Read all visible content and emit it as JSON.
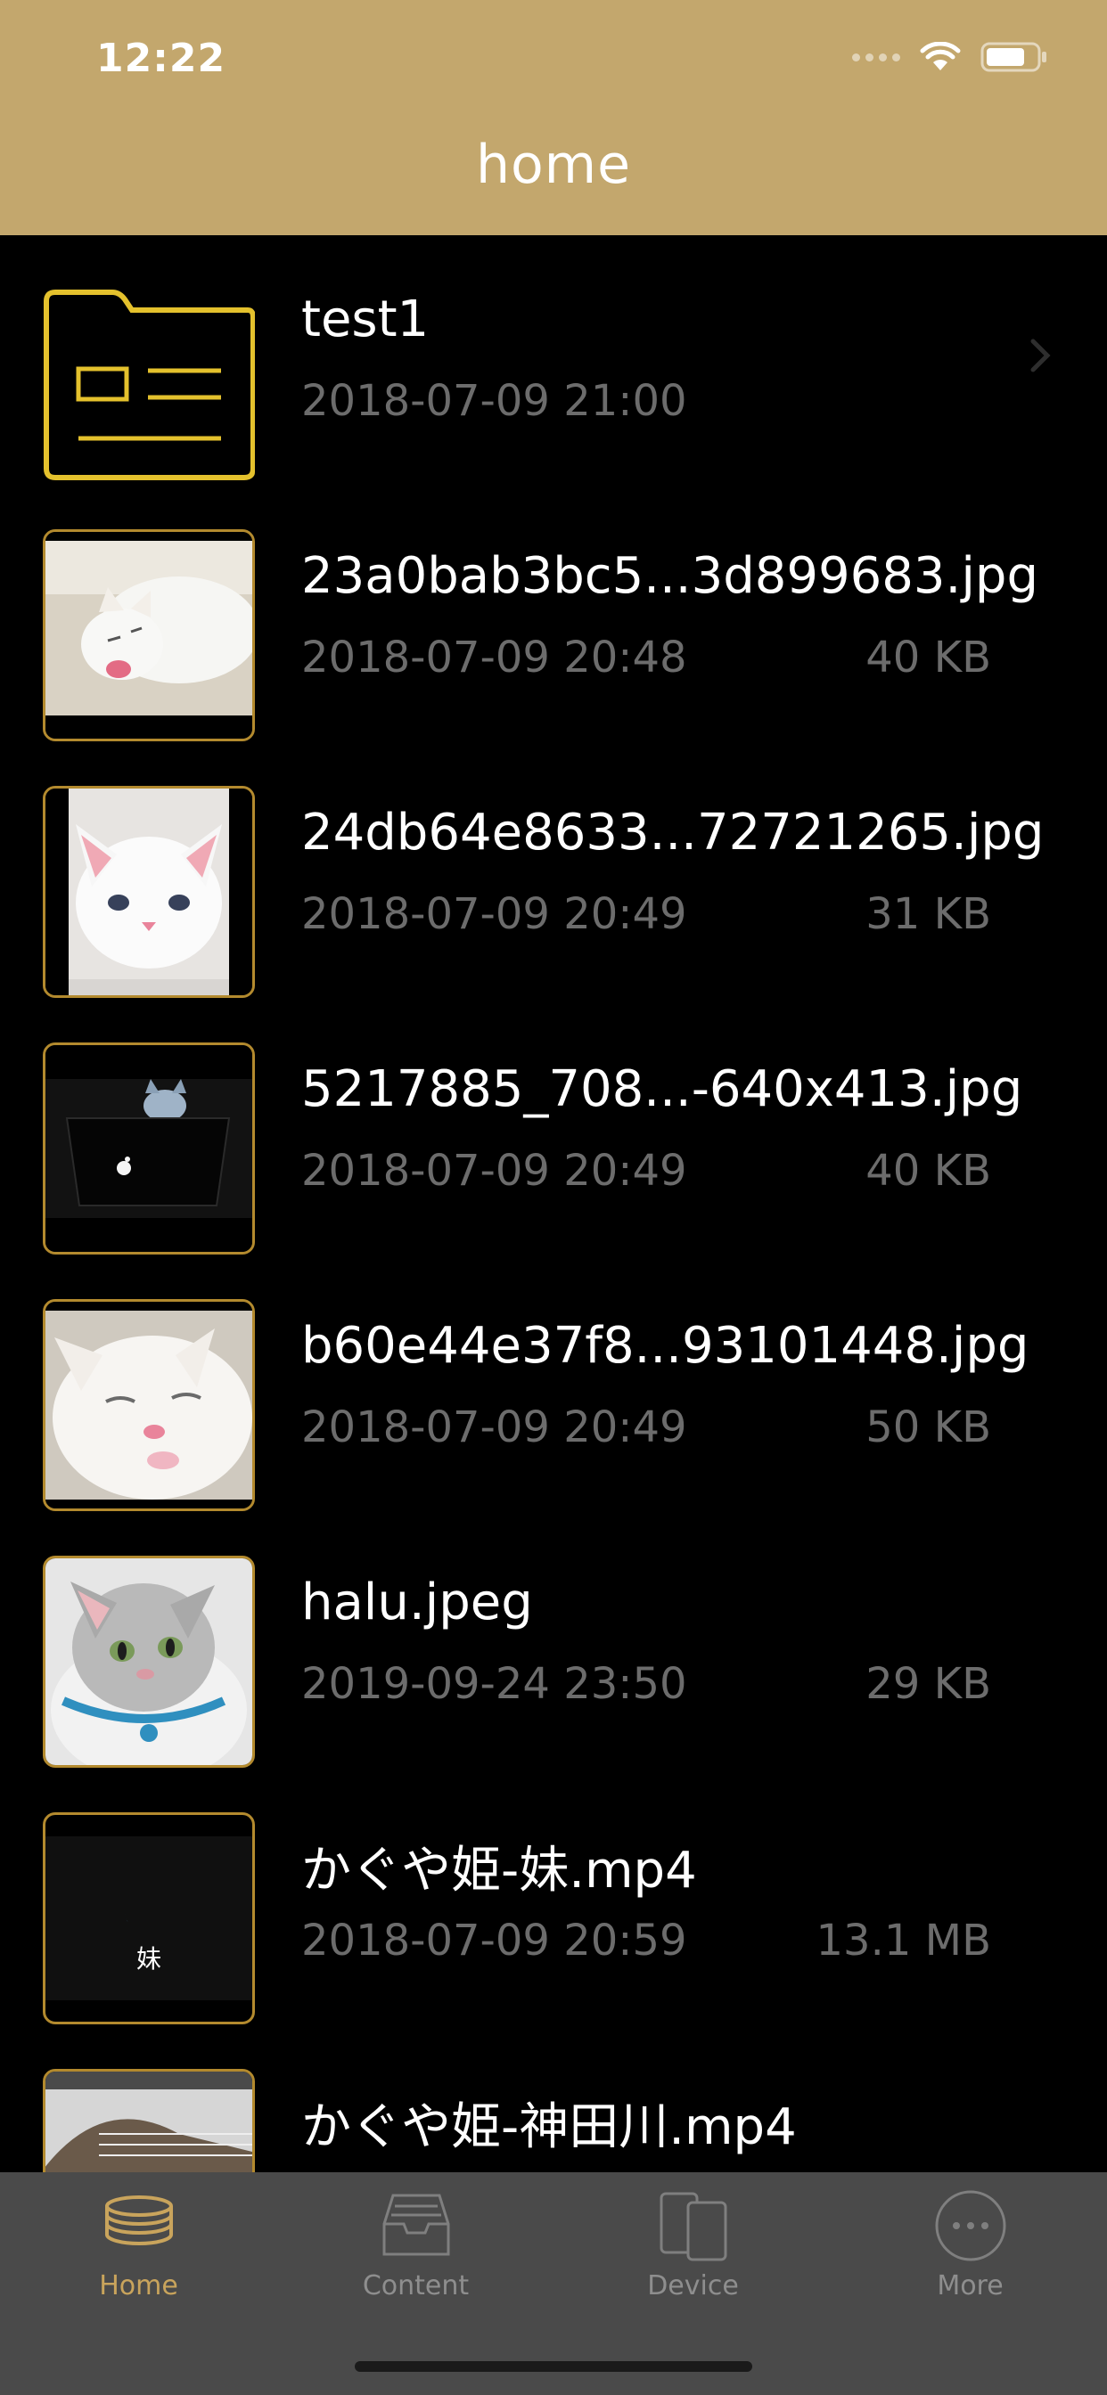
{
  "status_bar": {
    "time": "12:22"
  },
  "header": {
    "title": "home"
  },
  "files": [
    {
      "name": "test1",
      "date": "2018-07-09  21:00",
      "size": "",
      "type": "folder"
    },
    {
      "name": "23a0bab3bc5...3d899683.jpg",
      "date": "2018-07-09  20:48",
      "size": "40 KB",
      "type": "image"
    },
    {
      "name": "24db64e8633...72721265.jpg",
      "date": "2018-07-09  20:49",
      "size": "31 KB",
      "type": "image"
    },
    {
      "name": "5217885_708...-640x413.jpg",
      "date": "2018-07-09  20:49",
      "size": "40 KB",
      "type": "image"
    },
    {
      "name": "b60e44e37f8...93101448.jpg",
      "date": "2018-07-09  20:49",
      "size": "50 KB",
      "type": "image"
    },
    {
      "name": "halu.jpeg",
      "date": "2019-09-24  23:50",
      "size": "29 KB",
      "type": "image"
    },
    {
      "name": "かぐや姫-妹.mp4",
      "date": "2018-07-09  20:59",
      "size": "13.1 MB",
      "type": "video",
      "thumb_caption": "妹"
    },
    {
      "name": "かぐや姫-神田川.mp4",
      "date": "",
      "size": "",
      "type": "video"
    }
  ],
  "tabbar": {
    "tabs": [
      {
        "label": "Home",
        "icon": "stack-icon",
        "active": true
      },
      {
        "label": "Content",
        "icon": "inbox-tray-icon",
        "active": false
      },
      {
        "label": "Device",
        "icon": "devices-icon",
        "active": false
      },
      {
        "label": "More",
        "icon": "more-dots-icon",
        "active": false
      }
    ]
  },
  "colors": {
    "header_bg": "#c3a76d",
    "accent_gold": "#c9a45c",
    "thumb_border": "#b38a2e",
    "tabbar_bg": "#4a4a4a"
  }
}
